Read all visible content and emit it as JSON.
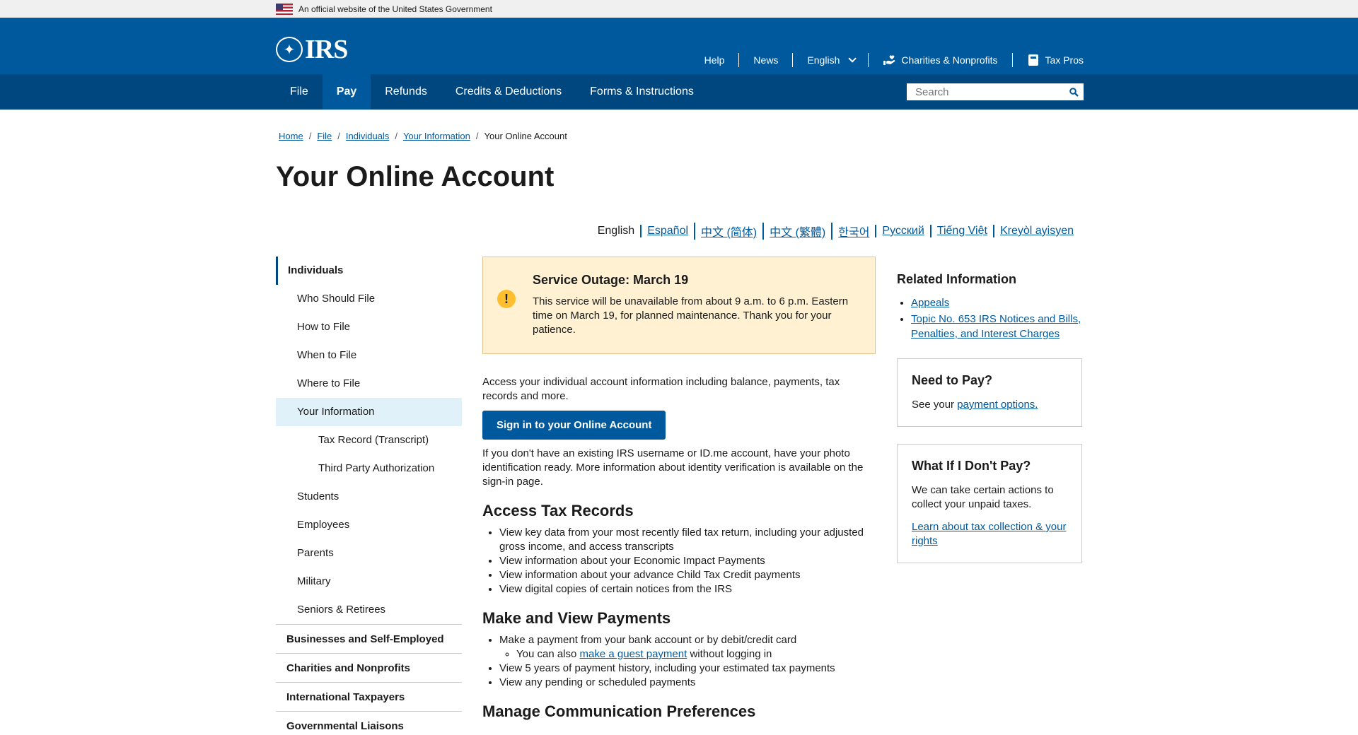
{
  "gov_banner": {
    "text": "An official website of the United States Government"
  },
  "header": {
    "logo_text": "IRS",
    "util_nav": [
      {
        "label": "Help"
      },
      {
        "label": "News"
      },
      {
        "label": "English"
      },
      {
        "label": "Charities & Nonprofits"
      },
      {
        "label": "Tax Pros"
      }
    ]
  },
  "mainnav": {
    "tabs": [
      {
        "label": "File"
      },
      {
        "label": "Pay"
      },
      {
        "label": "Refunds"
      },
      {
        "label": "Credits & Deductions"
      },
      {
        "label": "Forms & Instructions"
      }
    ],
    "active_tab": "Pay",
    "search_placeholder": "Search"
  },
  "breadcrumb": [
    "Home",
    "File",
    "Individuals",
    "Your Information",
    "Your Online Account"
  ],
  "page_title": "Your Online Account",
  "languages": [
    "English",
    "Español",
    "中文 (简体)",
    "中文 (繁體)",
    "한국어",
    "Русский",
    "Tiếng Việt",
    "Kreyòl ayisyen"
  ],
  "sidebar": {
    "head": "Individuals",
    "items": [
      "Who Should File",
      "How to File",
      "When to File",
      "Where to File",
      "Your Information",
      "Tax Record (Transcript)",
      "Third Party Authorization",
      "Students",
      "Employees",
      "Parents",
      "Military",
      "Seniors & Retirees"
    ],
    "sections": [
      "Businesses and Self-Employed",
      "Charities and Nonprofits",
      "International Taxpayers",
      "Governmental Liaisons"
    ]
  },
  "alert": {
    "icon": "exclamation-icon",
    "title": "Service Outage: March 19",
    "body": "This service will be unavailable from about 9 a.m. to 6 p.m. Eastern time on March 19, for planned maintenance. Thank you for your patience."
  },
  "content": {
    "intro": "Access your individual account information including balance, payments, tax records and more.",
    "signin_label": "Sign in to your Online Account",
    "note": "If you don't have an existing IRS username or ID.me account, have your photo identification ready. More information about identity verification is available on the sign-in page.",
    "sections": [
      {
        "heading": "Access Tax Records",
        "bullets": [
          "View key data from your most recently filed tax return, including your adjusted gross income, and access transcripts",
          "View information about your Economic Impact Payments",
          "View information about your advance Child Tax Credit payments",
          "View digital copies of certain notices from the IRS"
        ]
      },
      {
        "heading": "Make and View Payments",
        "bullet1": "Make a payment from your bank account or by debit/credit card",
        "sub_prefix": "You can also ",
        "sub_link": "make a guest payment",
        "sub_suffix": " without logging in",
        "bullets_after": [
          "View 5 years of payment history, including your estimated tax payments",
          "View any pending or scheduled payments"
        ]
      },
      {
        "heading": "Manage Communication Preferences"
      }
    ]
  },
  "right": {
    "related_title": "Related Information",
    "related_links": [
      "Appeals",
      "Topic No. 653 IRS Notices and Bills, Penalties, and Interest Charges"
    ],
    "need_to_pay": {
      "title": "Need to Pay?",
      "text_prefix": "See your ",
      "link": "payment options."
    },
    "what_if": {
      "title": "What If I Don't Pay?",
      "text": "We can take certain actions to collect your unpaid taxes.",
      "link": "Learn about tax collection & your rights"
    }
  }
}
